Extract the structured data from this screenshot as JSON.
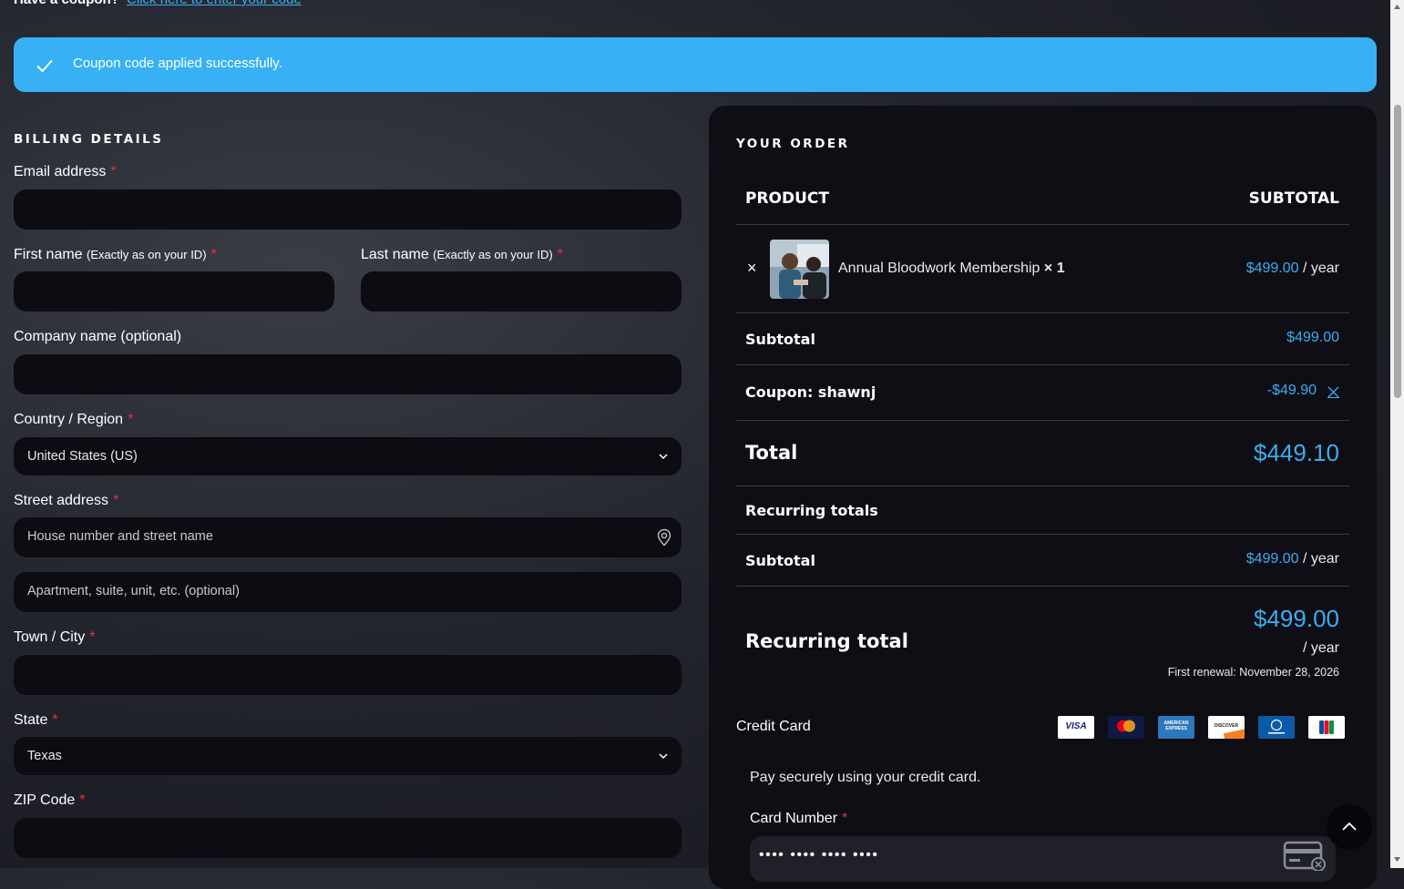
{
  "coupon_prompt": {
    "text": "Have a coupon?",
    "link": "Click here to enter your code"
  },
  "notice": {
    "message": "Coupon code applied successfully."
  },
  "billing": {
    "title": "BILLING DETAILS",
    "email_label": "Email address",
    "first_name_label": "First name",
    "first_name_hint": "(Exactly as on your ID)",
    "last_name_label": "Last name",
    "last_name_hint": "(Exactly as on your ID)",
    "company_label": "Company name (optional)",
    "country_label": "Country / Region",
    "country_value": "United States (US)",
    "street_label": "Street address",
    "street_placeholder": "House number and street name",
    "apartment_placeholder": "Apartment, suite, unit, etc. (optional)",
    "city_label": "Town / City",
    "state_label": "State",
    "state_value": "Texas",
    "zip_label": "ZIP Code",
    "required_mark": "*"
  },
  "order": {
    "title": "YOUR ORDER",
    "col_product": "PRODUCT",
    "col_subtotal": "SUBTOTAL",
    "remove_symbol": "×",
    "item_name": "Annual Bloodwork Membership",
    "item_qty": "× 1",
    "item_price": "$499.00",
    "item_period": "/ year",
    "subtotal_label": "Subtotal",
    "subtotal_value": "$499.00",
    "coupon_label": "Coupon: shawnj",
    "coupon_value": "-$49.90",
    "total_label": "Total",
    "total_value": "$449.10",
    "recurring_totals_label": "Recurring totals",
    "recurring_subtotal_label": "Subtotal",
    "recurring_subtotal_value": "$499.00",
    "recurring_subtotal_period": "/ year",
    "recurring_total_label": "Recurring total",
    "recurring_total_value": "$499.00",
    "recurring_total_period": "/ year",
    "first_renewal": "First renewal: November 28, 2026"
  },
  "payment": {
    "method_label": "Credit Card",
    "cards": [
      "visa",
      "mastercard",
      "amex",
      "discover",
      "diners",
      "jcb"
    ],
    "visa_text": "VISA",
    "amex_text": "AMERICAN EXPRESS",
    "discover_text": "DISCOVER",
    "description": "Pay securely using your credit card.",
    "card_number_label": "Card Number",
    "card_number_placeholder": "•••• •••• •••• ••••"
  },
  "colors": {
    "accent": "#3aaeef",
    "notice_bg": "#37b1f3",
    "required": "#e2343b",
    "panel": "#0e0e14"
  }
}
